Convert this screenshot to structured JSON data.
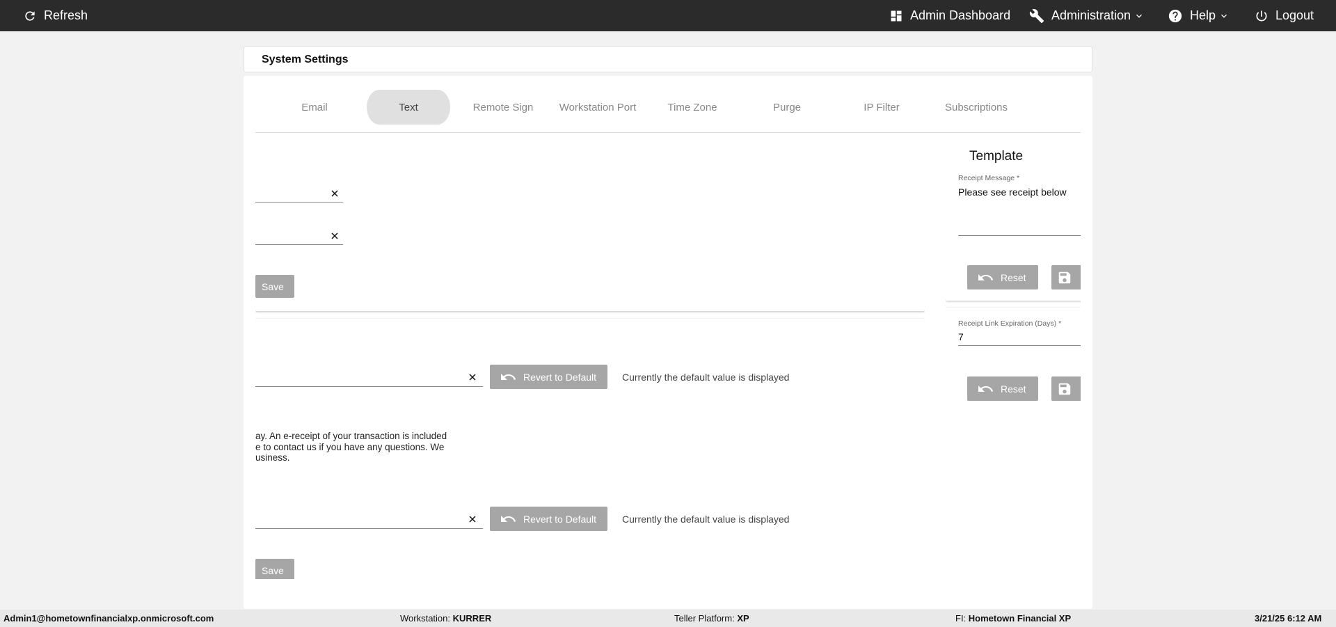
{
  "nav": {
    "refresh": "Refresh",
    "admin_dashboard": "Admin Dashboard",
    "administration": "Administration",
    "help": "Help",
    "logout": "Logout"
  },
  "page_title": "System Settings",
  "tabs": [
    {
      "label": "Email",
      "selected": true
    },
    {
      "label": "Text",
      "selected": false
    },
    {
      "label": "Remote Sign",
      "selected": false
    },
    {
      "label": "Workstation Port",
      "selected": false
    },
    {
      "label": "Time Zone",
      "selected": false
    },
    {
      "label": "Purge",
      "selected": false
    },
    {
      "label": "IP Filter",
      "selected": false
    },
    {
      "label": "Subscriptions",
      "selected": false
    }
  ],
  "left": {
    "save_label": "Save",
    "revert_label": "Revert to Default",
    "default_note": "Currently the default value is displayed",
    "message_lines": [
      "ay. An e-receipt of your transaction is included",
      "e to contact us if you have any questions. We",
      "usiness."
    ]
  },
  "right": {
    "template_title": "Template",
    "receipt_message_label": "Receipt Message *",
    "receipt_message_value": "Please see receipt below",
    "reset_label": "Reset",
    "expiration_label": "Receipt Link Expiration (Days) *",
    "expiration_value": "7"
  },
  "footer": {
    "user": "Admin1@hometownfinancialxp.onmicrosoft.com",
    "workstation_label": "Workstation:",
    "workstation_value": "KURRER",
    "platform_label": "Teller Platform:",
    "platform_value": "XP",
    "fi_label": "FI:",
    "fi_value": "Hometown Financial XP",
    "datetime": "3/21/25 6:12 AM"
  },
  "colors": {
    "topbar": "#2b2b2b",
    "tab_underline": "#3f51b5",
    "button_disabled": "#a6a6a6"
  }
}
